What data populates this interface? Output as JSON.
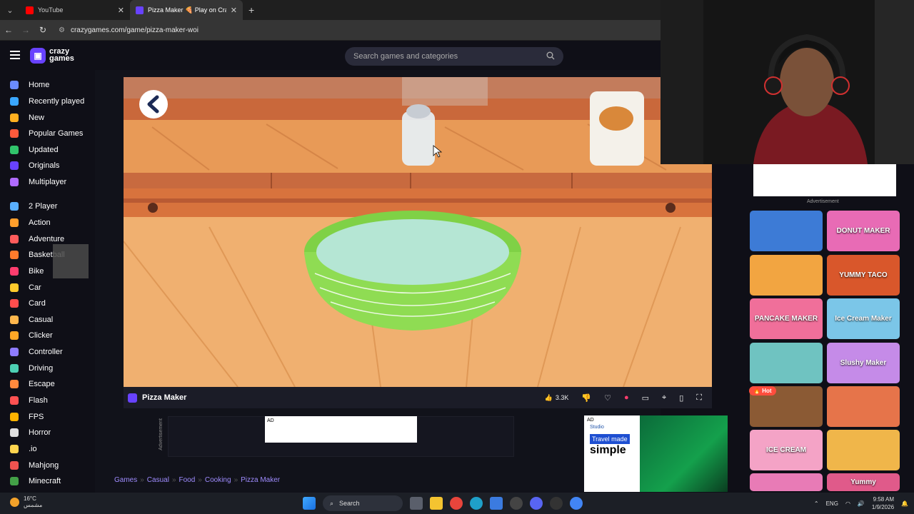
{
  "browser": {
    "tabs": [
      {
        "label": "YouTube",
        "favicon_color": "#ff0000"
      },
      {
        "label": "Pizza Maker 🍕 Play on Cra",
        "favicon_color": "#6842ff"
      }
    ],
    "new_tab_symbol": "+",
    "url": "crazygames.com/game/pizza-maker-woi"
  },
  "site": {
    "logo_line1": "crazy",
    "logo_line2": "games",
    "search_placeholder": "Search games and categories"
  },
  "sidebar": {
    "items": [
      {
        "label": "Home",
        "color": "#6b8cff"
      },
      {
        "label": "Recently played",
        "color": "#3aa7ff"
      },
      {
        "label": "New",
        "color": "#ffb020"
      },
      {
        "label": "Popular Games",
        "color": "#ff5a3c"
      },
      {
        "label": "Updated",
        "color": "#31c46b"
      },
      {
        "label": "Originals",
        "color": "#6842ff"
      },
      {
        "label": "Multiplayer",
        "color": "#b06bff"
      },
      {
        "label": "2 Player",
        "color": "#5ab0ff"
      },
      {
        "label": "Action",
        "color": "#ff9e2c"
      },
      {
        "label": "Adventure",
        "color": "#ff5c5c"
      },
      {
        "label": "Basketball",
        "color": "#ff7b2c"
      },
      {
        "label": "Bike",
        "color": "#ff3d6e"
      },
      {
        "label": "Car",
        "color": "#ffca2c"
      },
      {
        "label": "Card",
        "color": "#ff4d4d"
      },
      {
        "label": "Casual",
        "color": "#ffb74d"
      },
      {
        "label": "Clicker",
        "color": "#ffa726"
      },
      {
        "label": "Controller",
        "color": "#8e7bff"
      },
      {
        "label": "Driving",
        "color": "#4dd0b4"
      },
      {
        "label": "Escape",
        "color": "#ff8a3d"
      },
      {
        "label": "Flash",
        "color": "#ff5252"
      },
      {
        "label": "FPS",
        "color": "#ffb300"
      },
      {
        "label": "Horror",
        "color": "#e0e0e0"
      },
      {
        "label": ".io",
        "color": "#ffd54f"
      },
      {
        "label": "Mahjong",
        "color": "#ef5350"
      },
      {
        "label": "Minecraft",
        "color": "#43a047"
      }
    ]
  },
  "game": {
    "title": "Pizza Maker",
    "likes": "3.3K"
  },
  "ads": {
    "ad_label": "AD",
    "advertisement_vertical": "Advertisement",
    "rail_label": "Advertisement",
    "ad2_brand": "Studio",
    "ad2_line1": "Travel made",
    "ad2_line2": "simple"
  },
  "breadcrumb": [
    "Games",
    "Casual",
    "Food",
    "Cooking",
    "Pizza Maker"
  ],
  "rail": {
    "hot_label": "Hot",
    "thumbs": [
      {
        "label": "",
        "color": "#3d7bd6"
      },
      {
        "label": "DONUT MAKER",
        "color": "#e86bb5"
      },
      {
        "label": "",
        "color": "#f2a541"
      },
      {
        "label": "YUMMY TACO",
        "color": "#d9572b"
      },
      {
        "label": "PANCAKE MAKER",
        "color": "#f06f9a"
      },
      {
        "label": "Ice Cream Maker",
        "color": "#7bc6e8"
      },
      {
        "label": "",
        "color": "#6fc3c1"
      },
      {
        "label": "Slushy Maker",
        "color": "#c58be8"
      },
      {
        "label": "",
        "color": "#8b5a34"
      },
      {
        "label": "",
        "color": "#e6744a"
      },
      {
        "label": "ICE CREAM",
        "color": "#f4a3c6"
      },
      {
        "label": "",
        "color": "#f0b64a"
      },
      {
        "label": "",
        "color": "#e87bb6"
      },
      {
        "label": "Yummy",
        "color": "#e05a8a"
      }
    ]
  },
  "taskbar": {
    "temperature": "16°C",
    "weather_text": "مشمس",
    "search_label": "Search",
    "language": "ENG",
    "time": "9:58 AM",
    "date": "1/9/2026"
  }
}
